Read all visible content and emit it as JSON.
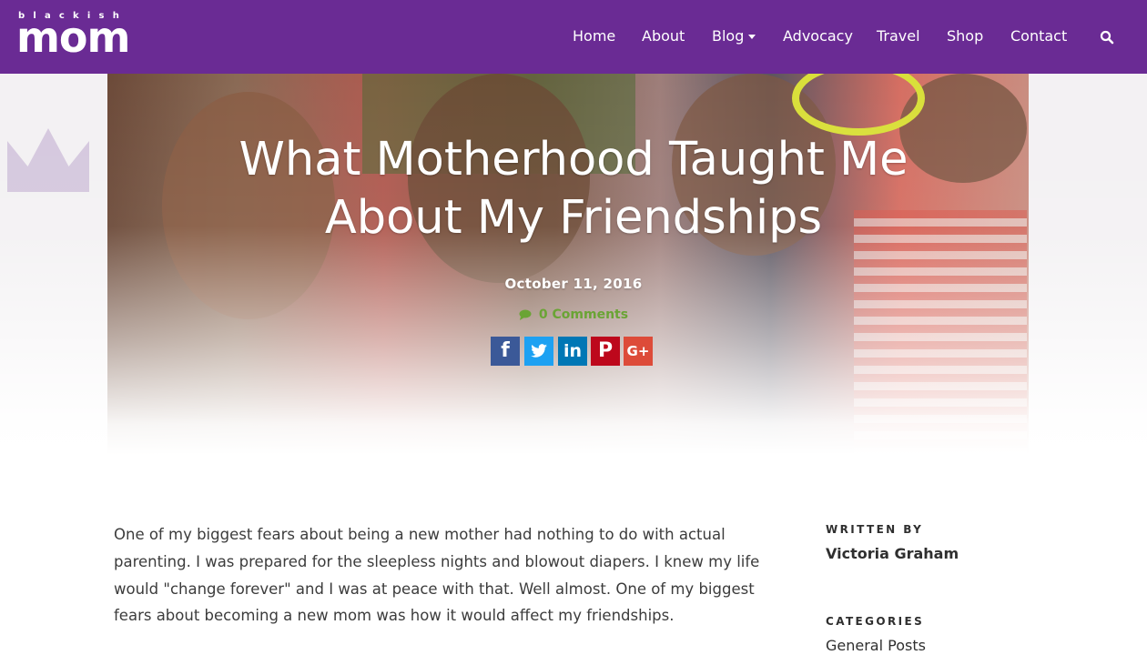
{
  "brand": {
    "logo_small": "blackish",
    "logo_big": "mom",
    "header_color": "#6a2b94"
  },
  "nav": {
    "items": [
      {
        "label": "Home"
      },
      {
        "label": "About"
      },
      {
        "label": "Blog"
      },
      {
        "label": "Advocacy"
      },
      {
        "label": "Travel"
      },
      {
        "label": "Shop"
      },
      {
        "label": "Contact"
      }
    ],
    "search_icon": "search-icon"
  },
  "post": {
    "title": "What Motherhood Taught Me About My Friendships",
    "date": "October 11, 2016",
    "comments": "0 Comments",
    "share": [
      {
        "name": "facebook",
        "glyph": "f",
        "color": "#3b5998"
      },
      {
        "name": "twitter",
        "glyph": "t",
        "color": "#1da1f2"
      },
      {
        "name": "linkedin",
        "glyph": "in",
        "color": "#0077b5"
      },
      {
        "name": "pinterest",
        "glyph": "P",
        "color": "#bd081c"
      },
      {
        "name": "google-plus",
        "glyph": "G+",
        "color": "#dd4b39"
      }
    ],
    "body": "One of my biggest fears about being a new mother had nothing to do with actual parenting. I was prepared for the sleepless nights and blowout diapers. I knew my life would \"change forever\" and I was at peace with that. Well almost. One of my biggest fears about becoming a new mom was how it would affect my friendships."
  },
  "sidebar": {
    "written_by_label": "WRITTEN BY",
    "author": "Victoria Graham",
    "categories_label": "CATEGORIES",
    "category": "General Posts"
  }
}
